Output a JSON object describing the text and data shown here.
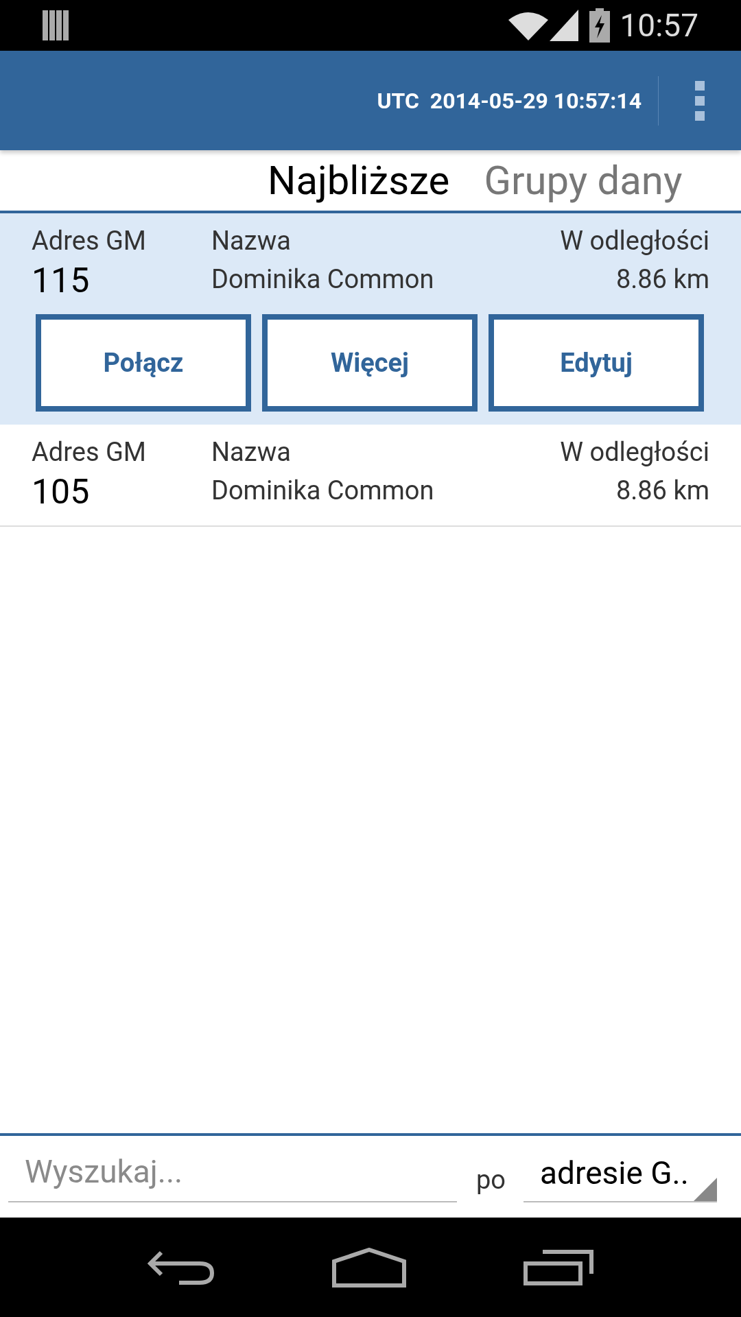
{
  "status_bar": {
    "time": "10:57"
  },
  "action_bar": {
    "clock": "UTC  2014-05-29 10:57:14"
  },
  "tabs": [
    {
      "label": "Najbliższe",
      "selected": true
    },
    {
      "label": "Grupy dany",
      "selected": false
    }
  ],
  "rows": [
    {
      "address_label": "Adres GM",
      "address": "115",
      "name_label": "Nazwa",
      "name": "Dominika Common",
      "distance_label": "W odległości",
      "distance": "8.86 km",
      "expanded": true,
      "actions": [
        "Połącz",
        "Więcej",
        "Edytuj"
      ]
    },
    {
      "address_label": "Adres GM",
      "address": "105",
      "name_label": "Nazwa",
      "name": "Dominika Common",
      "distance_label": "W odległości",
      "distance": "8.86 km",
      "expanded": false
    }
  ],
  "search": {
    "placeholder": "Wyszukaj...",
    "by_label": "po",
    "by_value": "adresie G.."
  }
}
